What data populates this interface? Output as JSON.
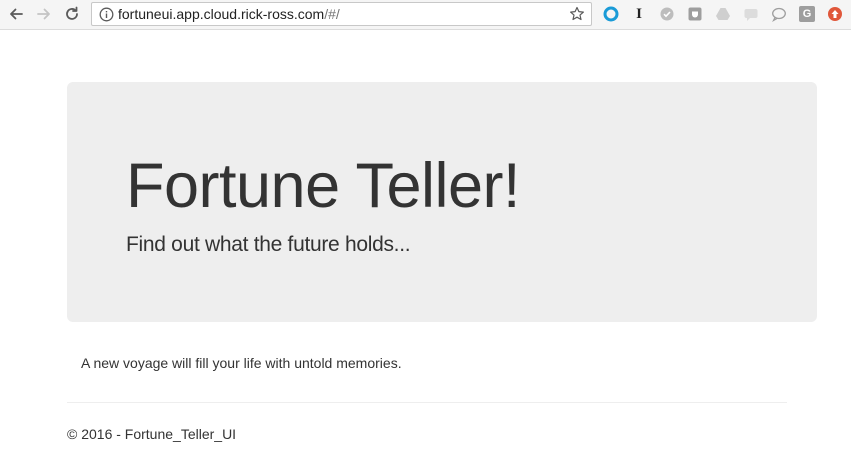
{
  "browser": {
    "url_host": "fortuneui.app.cloud.rick-ross.com",
    "url_path": "/#/",
    "icons": {
      "back": "back-arrow-icon",
      "forward": "forward-arrow-icon",
      "reload": "reload-icon",
      "info": "info-icon",
      "bookmark": "star-icon"
    },
    "extensions": [
      {
        "name": "blue-ring-extension-icon",
        "label": "",
        "color": "#1a9bd7"
      },
      {
        "name": "instapaper-extension-icon",
        "label": "I",
        "color": "#222222"
      },
      {
        "name": "check-circle-extension-icon",
        "label": "",
        "color": "#9e9e9e"
      },
      {
        "name": "pocket-extension-icon",
        "label": "",
        "color": "#9e9e9e"
      },
      {
        "name": "drive-extension-icon",
        "label": "",
        "color": "#bdbdbd"
      },
      {
        "name": "chat-extension-icon",
        "label": "",
        "color": "#cfcfcf"
      },
      {
        "name": "speech-bubble-extension-icon",
        "label": "",
        "color": "#9e9e9e"
      },
      {
        "name": "google-extension-icon",
        "label": "G",
        "color": "#9e9e9e"
      },
      {
        "name": "upload-extension-icon",
        "label": "",
        "color": "#e0573a"
      }
    ]
  },
  "page": {
    "title": "Fortune Teller!",
    "subtitle": "Find out what the future holds...",
    "fortune": "A new voyage will fill your life with untold memories.",
    "footer": "© 2016 - Fortune_Teller_UI"
  },
  "colors": {
    "jumbotron_bg": "#eeeeee",
    "text": "#333333"
  }
}
